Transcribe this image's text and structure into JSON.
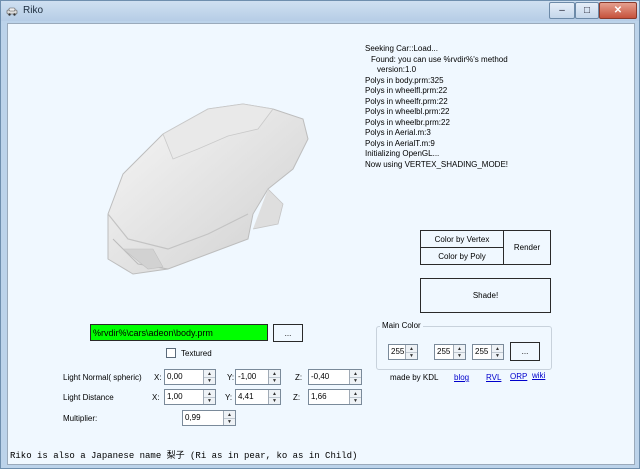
{
  "window": {
    "title": "Riko"
  },
  "log": {
    "lines": [
      "Seeking Car::Load...",
      "Found: you can use %rvdir%'s method",
      "version:1.0",
      "Polys in body.prm:325",
      "Polys in wheelfl.prm:22",
      "Polys in wheelfr.prm:22",
      "Polys in wheelbl.prm:22",
      "Polys in wheelbr.prm:22",
      "Polys in Aerial.m:3",
      "Polys in AerialT.m:9",
      "Initializing OpenGL...",
      "Now using VERTEX_SHADING_MODE!"
    ]
  },
  "buttons": {
    "color_by_vertex": "Color by Vertex",
    "color_by_poly": "Color by Poly",
    "render": "Render",
    "shade": "Shade!",
    "browse": "...",
    "color_picker": "..."
  },
  "file": {
    "path": "%rvdir%\\cars\\adeon\\body.prm",
    "textured_label": "Textured",
    "textured_checked": false
  },
  "main_color": {
    "label": "Main Color",
    "r": "255",
    "g": "255",
    "b": "255"
  },
  "credits": {
    "made_by": "made by KDL",
    "links": [
      "blog",
      "RVL",
      "ORP",
      "wiki"
    ]
  },
  "light_normal": {
    "label": "Light Normal( spheric)",
    "x_label": "X:",
    "y_label": "Y:",
    "z_label": "Z:",
    "x": "0,00",
    "y": "-1,00",
    "z": "-0,40"
  },
  "light_distance": {
    "label": "Light Distance",
    "x_label": "X:",
    "y_label": "Y:",
    "z_label": "Z:",
    "x": "1,00",
    "y": "4,41",
    "z": "1,66"
  },
  "multiplier": {
    "label": "Multiplier:",
    "value": "0,99"
  },
  "status_text": "Riko is also a Japanese name 梨子 (Ri as in pear, ko as in Child)",
  "colors": {
    "path_field": "#00ff00",
    "client_bg": "#f0f8ff"
  },
  "icons": {
    "app": "car-app-icon",
    "minimize": "minimize-icon",
    "maximize": "maximize-icon",
    "close": "close-icon"
  }
}
